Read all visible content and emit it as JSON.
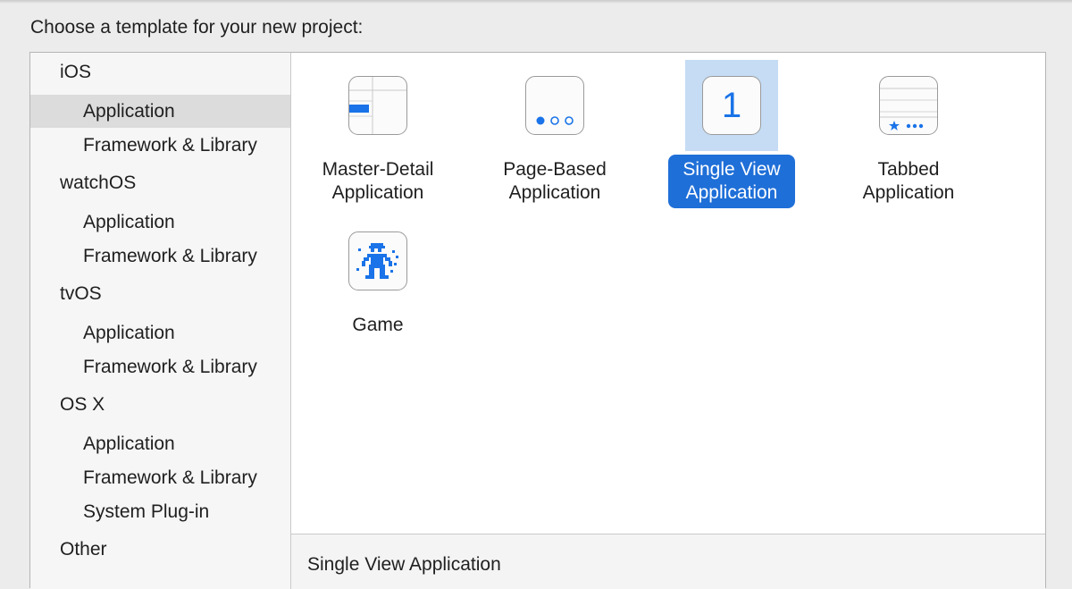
{
  "prompt": "Choose a template for your new project:",
  "sidebar": {
    "groups": [
      {
        "platform": "iOS",
        "items": [
          "Application",
          "Framework & Library"
        ]
      },
      {
        "platform": "watchOS",
        "items": [
          "Application",
          "Framework & Library"
        ]
      },
      {
        "platform": "tvOS",
        "items": [
          "Application",
          "Framework & Library"
        ]
      },
      {
        "platform": "OS X",
        "items": [
          "Application",
          "Framework & Library",
          "System Plug-in"
        ]
      },
      {
        "platform": "Other",
        "items": []
      }
    ],
    "selected": "iOS / Application"
  },
  "templates": [
    {
      "label": "Master-Detail\nApplication",
      "icon": "master-detail-icon"
    },
    {
      "label": "Page-Based\nApplication",
      "icon": "page-based-icon"
    },
    {
      "label": "Single View\nApplication",
      "icon": "single-view-icon",
      "icon_text": "1",
      "selected": true
    },
    {
      "label": "Tabbed\nApplication",
      "icon": "tabbed-icon"
    },
    {
      "label": "Game",
      "icon": "game-icon"
    }
  ],
  "description": {
    "title": "Single View Application"
  },
  "colors": {
    "accent": "#1f6fd8",
    "selection_bg": "#c5dcf4",
    "sidebar_selected": "#dcdcdc",
    "icon_blue": "#1a73e8"
  }
}
